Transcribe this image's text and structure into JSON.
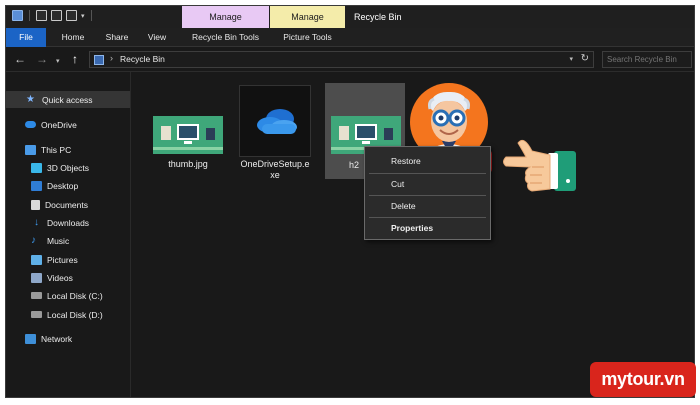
{
  "window": {
    "title": "Recycle Bin",
    "context_tabs": [
      "Manage",
      "Manage"
    ]
  },
  "ribbon": {
    "tabs": [
      "File",
      "Home",
      "Share",
      "View",
      "Recycle Bin Tools",
      "Picture Tools"
    ]
  },
  "address": {
    "path": "Recycle Bin",
    "search_placeholder": "Search Recycle Bin"
  },
  "sidebar": {
    "items": [
      {
        "label": "Quick access",
        "icon": "star-icon"
      },
      {
        "label": "OneDrive",
        "icon": "cloud-icon"
      },
      {
        "label": "This PC",
        "icon": "computer-icon"
      },
      {
        "label": "3D Objects",
        "icon": "cube-icon"
      },
      {
        "label": "Desktop",
        "icon": "desktop-icon"
      },
      {
        "label": "Documents",
        "icon": "document-icon"
      },
      {
        "label": "Downloads",
        "icon": "download-icon"
      },
      {
        "label": "Music",
        "icon": "music-icon"
      },
      {
        "label": "Pictures",
        "icon": "pictures-icon"
      },
      {
        "label": "Videos",
        "icon": "video-icon"
      },
      {
        "label": "Local Disk (C:)",
        "icon": "disk-icon"
      },
      {
        "label": "Local Disk (D:)",
        "icon": "disk-icon"
      },
      {
        "label": "Network",
        "icon": "network-icon"
      }
    ]
  },
  "files": [
    {
      "name": "thumb.jpg"
    },
    {
      "name_line1": "OneDriveSetup.e",
      "name_line2": "xe"
    },
    {
      "name": "h2"
    }
  ],
  "context_menu": {
    "items": [
      "Restore",
      "Cut",
      "Delete",
      "Properties"
    ]
  },
  "logo": {
    "text": "mytour.vn"
  },
  "colors": {
    "accent": "#1b64c6",
    "highlight": "#e02424",
    "logo": "#d9251c"
  }
}
